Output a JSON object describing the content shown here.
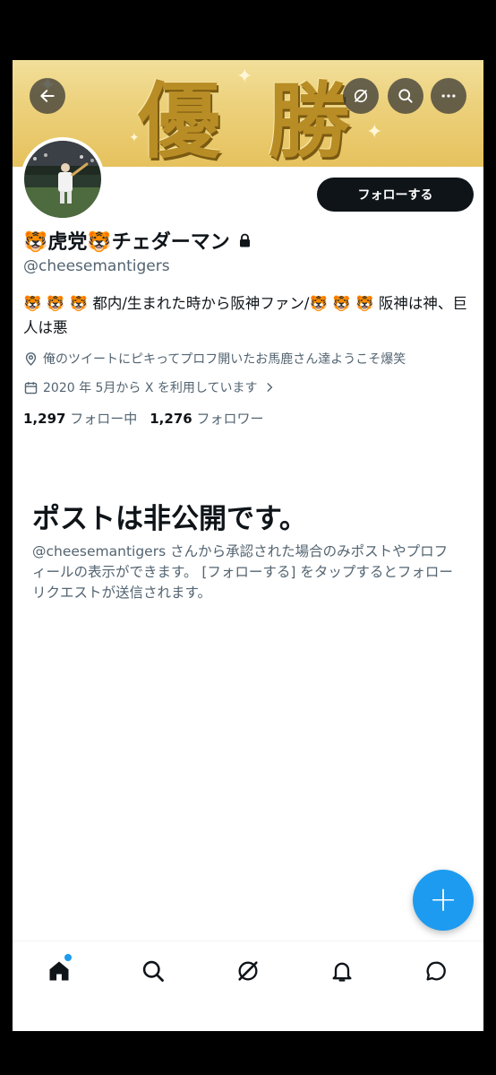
{
  "banner": {
    "text_left": "優",
    "text_right": "勝",
    "color": "#e8c86a"
  },
  "header_buttons": {
    "back_icon": "back-arrow-icon",
    "grok_icon": "grok-icon",
    "search_icon": "search-icon",
    "more_icon": "more-icon"
  },
  "profile": {
    "follow_label": "フォローする",
    "name": "🐯虎党🐯チェダーマン",
    "handle": "@cheesemantigers",
    "bio": "🐯 🐯 🐯 都内/生まれた時から阪神ファン/🐯 🐯 🐯 阪神は神、巨人は悪",
    "location": "俺のツイートにピキってプロフ開いたお馬鹿さん達ようこそ爆笑",
    "joined": "2020 年 5月から X を利用しています",
    "following_count": "1,297",
    "following_label": "フォロー中",
    "followers_count": "1,276",
    "followers_label": "フォロワー"
  },
  "private_notice": {
    "title": "ポストは非公開です。",
    "body": "@cheesemantigers さんから承認された場合のみポストやプロフィールの表示ができます。 [フォローする] をタップするとフォローリクエストが送信されます。"
  },
  "fab": {
    "label": "+"
  },
  "colors": {
    "accent": "#1d9bf0",
    "text": "#0f1419",
    "secondary": "#536471"
  }
}
